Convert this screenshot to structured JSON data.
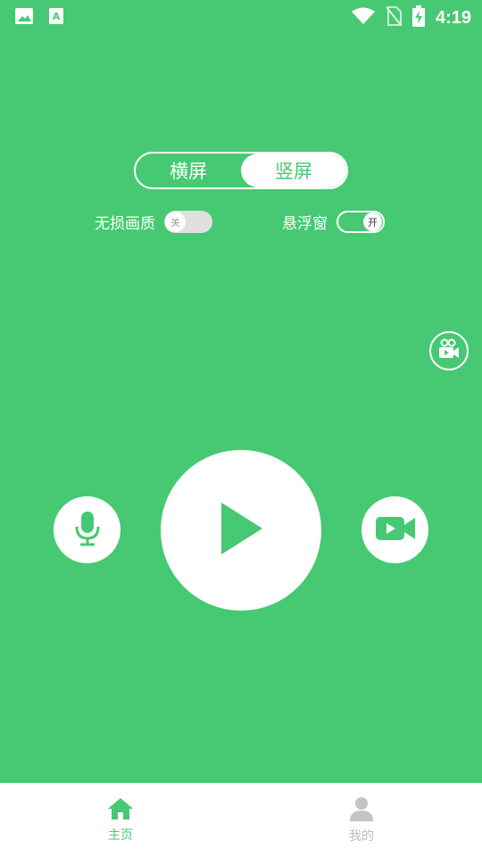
{
  "status_bar": {
    "time": "4:19",
    "left_icons": [
      "image-icon",
      "a-icon"
    ],
    "right_icons": [
      "wifi-icon",
      "no-sim-icon",
      "battery-charging-icon"
    ]
  },
  "orientation": {
    "landscape": "横屏",
    "portrait": "竖屏",
    "selected": "portrait"
  },
  "settings": {
    "lossless": {
      "label": "无损画质",
      "state_label": "关",
      "enabled": false
    },
    "floating": {
      "label": "悬浮窗",
      "state_label": "开",
      "enabled": true
    }
  },
  "buttons": {
    "mic": "mic-icon",
    "play": "play-icon",
    "camera": "video-camera-icon",
    "recorder": "film-camera-icon"
  },
  "nav": {
    "home": "主页",
    "mine": "我的"
  },
  "colors": {
    "accent": "#46C972",
    "inactive": "#bbbbbb"
  }
}
